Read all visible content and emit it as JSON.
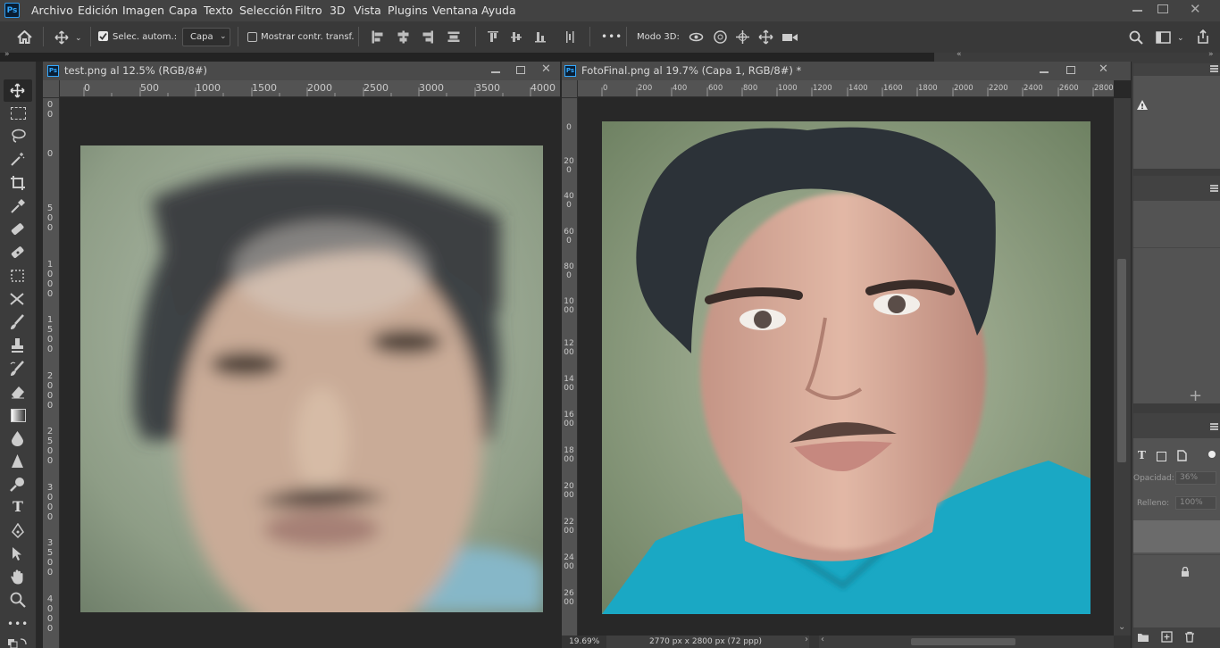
{
  "app": {
    "logo": "Ps"
  },
  "menu": [
    "Archivo",
    "Edición",
    "Imagen",
    "Capa",
    "Texto",
    "Selección",
    "Filtro",
    "3D",
    "Vista",
    "Plugins",
    "Ventana",
    "Ayuda"
  ],
  "options_bar": {
    "auto_select_label": "Selec. autom.:",
    "auto_select_checked": true,
    "auto_select_target": "Capa",
    "show_transform_label": "Mostrar contr. transf.",
    "show_transform_checked": false,
    "more_label": "•••",
    "mode_3d_label": "Modo 3D:"
  },
  "doc_left": {
    "title": "test.png al 12.5% (RGB/8#)",
    "ruler_h": [
      "0",
      "500",
      "1000",
      "1500",
      "2000",
      "2500",
      "3000",
      "3500",
      "4000"
    ],
    "ruler_v": [
      "0",
      "500",
      "1000",
      "1500",
      "2000",
      "2500",
      "3000",
      "3500",
      "4000"
    ]
  },
  "doc_right": {
    "title": "FotoFinal.png al 19.7% (Capa 1, RGB/8#) *",
    "ruler_h": [
      "0",
      "200",
      "400",
      "600",
      "800",
      "1000",
      "1200",
      "1400",
      "1600",
      "1800",
      "2000",
      "2200",
      "2400",
      "2600",
      "2800"
    ],
    "ruler_v": [
      "0",
      "200",
      "400",
      "600",
      "800",
      "1000",
      "1200",
      "1400",
      "1600",
      "1800",
      "2000",
      "2200",
      "2400",
      "2600"
    ],
    "zoom": "19.69%",
    "doc_size": "2770 px x 2800 px (72 ppp)"
  },
  "panels": {
    "opacity_label": "Opacidad:",
    "opacity_value": "36%",
    "fill_label": "Relleno:",
    "fill_value": "100%",
    "add_label": "+"
  },
  "colors": {
    "accent": "#31a8ff",
    "menubar": "#424242",
    "workspace": "#282828",
    "panel": "#535353"
  }
}
